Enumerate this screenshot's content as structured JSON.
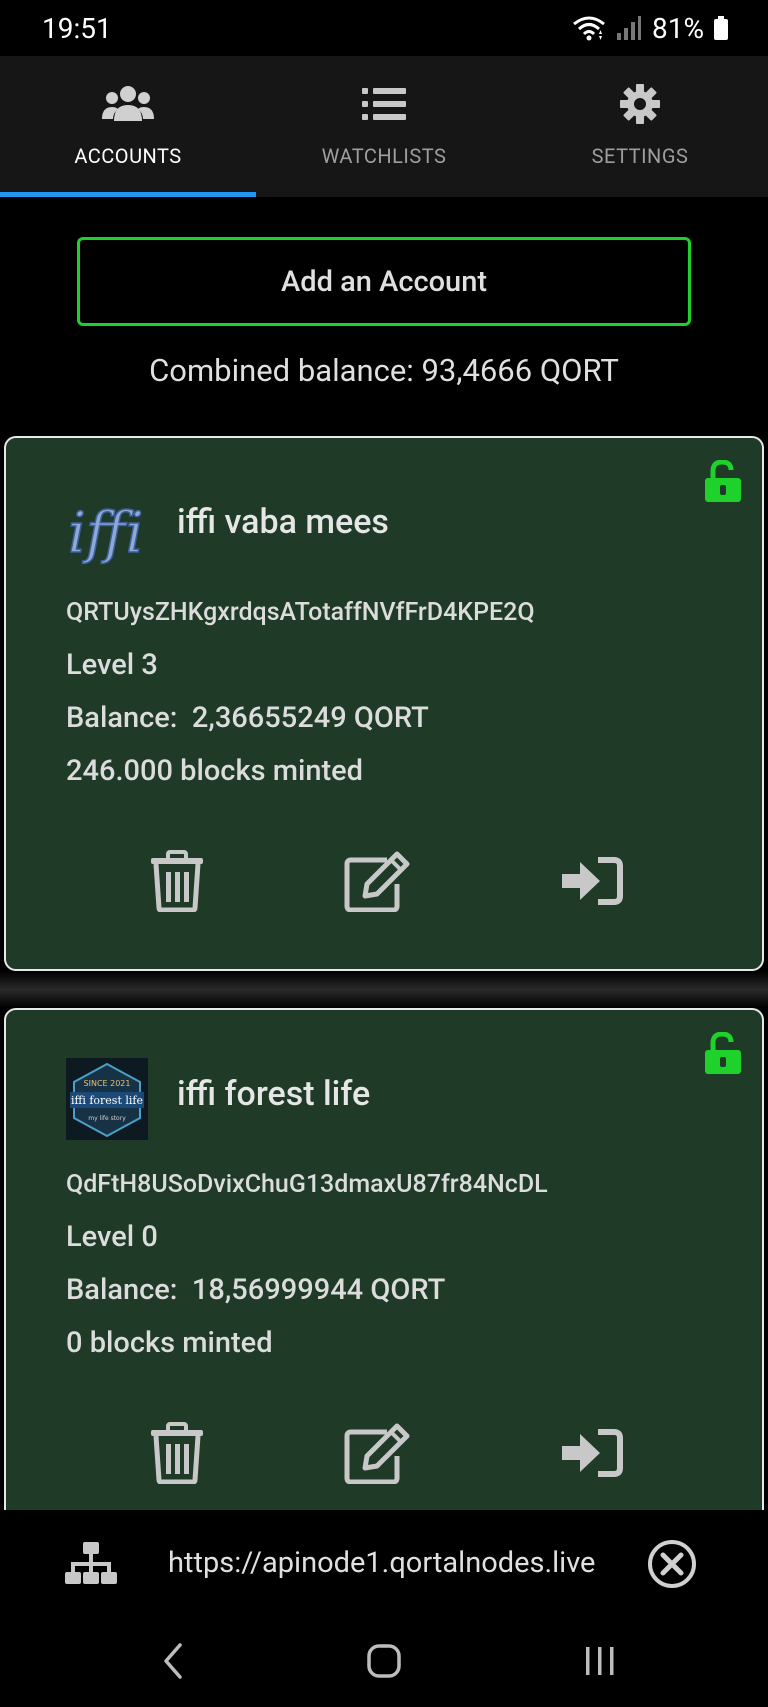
{
  "status": {
    "time": "19:51",
    "battery": "81%",
    "icons": [
      "wifi-icon",
      "signal-icon",
      "battery-icon"
    ]
  },
  "tabs": [
    {
      "label": "ACCOUNTS",
      "icon": "users-icon",
      "active": true
    },
    {
      "label": "WATCHLISTS",
      "icon": "list-icon",
      "active": false
    },
    {
      "label": "SETTINGS",
      "icon": "gear-icon",
      "active": false
    }
  ],
  "add_account_label": "Add an Account",
  "combined_balance": "Combined balance: 93,4666 QORT",
  "accounts": [
    {
      "name": "iffi vaba mees",
      "address": "QRTUysZHKgxrdqsATotaffNVfFrD4KPE2Q",
      "level": "Level 3",
      "balance_label": "Balance:",
      "balance_value": "2,36655249 QORT",
      "blocks": "246.000 blocks minted",
      "avatar_text": "iffi",
      "lock_state": "unlocked"
    },
    {
      "name": "iffi forest life",
      "address": "QdFtH8USoDvixChuG13dmaxU87fr84NcDL",
      "level": "Level 0",
      "balance_label": "Balance:",
      "balance_value": "18,56999944 QORT",
      "blocks": "0 blocks minted",
      "avatar_top": "SINCE 2021",
      "avatar_title": "iffi forest life",
      "avatar_sub": "my life story",
      "lock_state": "unlocked"
    }
  ],
  "node": {
    "url": "https://apinode1.qortalnodes.live"
  },
  "colors": {
    "accent_green": "#1ed12b",
    "tab_indicator": "#2196f3",
    "card_bg": "#1f3a27"
  }
}
